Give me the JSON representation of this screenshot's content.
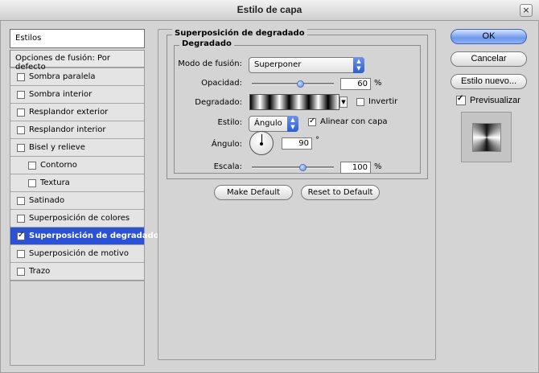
{
  "window": {
    "title": "Estilo de capa",
    "close_glyph": "×"
  },
  "left": {
    "header": "Estilos",
    "fusion": "Opciones de fusión: Por defecto",
    "items": [
      {
        "label": "Sombra paralela",
        "checked": false,
        "indent": false,
        "selected": false
      },
      {
        "label": "Sombra interior",
        "checked": false,
        "indent": false,
        "selected": false
      },
      {
        "label": "Resplandor exterior",
        "checked": false,
        "indent": false,
        "selected": false
      },
      {
        "label": "Resplandor interior",
        "checked": false,
        "indent": false,
        "selected": false
      },
      {
        "label": "Bisel y relieve",
        "checked": false,
        "indent": false,
        "selected": false
      },
      {
        "label": "Contorno",
        "checked": false,
        "indent": true,
        "selected": false
      },
      {
        "label": "Textura",
        "checked": false,
        "indent": true,
        "selected": false
      },
      {
        "label": "Satinado",
        "checked": false,
        "indent": false,
        "selected": false
      },
      {
        "label": "Superposición de colores",
        "checked": false,
        "indent": false,
        "selected": false
      },
      {
        "label": "Superposición de degradado",
        "checked": true,
        "indent": false,
        "selected": true
      },
      {
        "label": "Superposición de motivo",
        "checked": false,
        "indent": false,
        "selected": false
      },
      {
        "label": "Trazo",
        "checked": false,
        "indent": false,
        "selected": false
      }
    ]
  },
  "main": {
    "section_title": "Superposición de degradado",
    "group_title": "Degradado",
    "blend_mode_label": "Modo de fusión:",
    "blend_mode_value": "Superponer",
    "opacity_label": "Opacidad:",
    "opacity_value": "60",
    "opacity_fraction": 0.6,
    "percent": "%",
    "gradient_label": "Degradado:",
    "invert_label": "Invertir",
    "invert_checked": false,
    "style_label": "Estilo:",
    "style_value": "Ángulo",
    "align_label": "Alinear con capa",
    "align_checked": true,
    "angle_label": "Ángulo:",
    "angle_value": "90",
    "degree": "°",
    "scale_label": "Escala:",
    "scale_value": "100",
    "scale_fraction": 0.63,
    "make_default": "Make Default",
    "reset_default": "Reset to Default"
  },
  "right": {
    "ok": "OK",
    "cancel": "Cancelar",
    "new_style": "Estilo nuevo...",
    "preview_label": "Previsualizar",
    "preview_checked": true
  },
  "colors": {
    "selection": "#2b52d4",
    "primary_button": "#6d98ec"
  }
}
